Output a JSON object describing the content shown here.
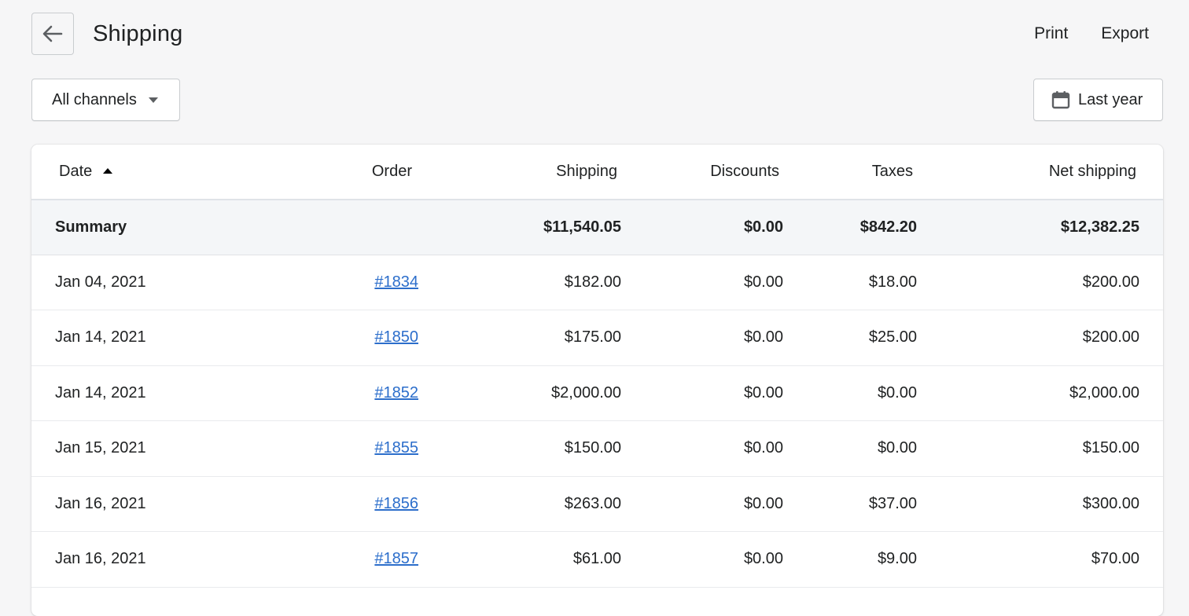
{
  "header": {
    "title": "Shipping",
    "actions": [
      "Print",
      "Export"
    ]
  },
  "filters": {
    "channel": "All channels",
    "date_range": "Last year"
  },
  "table": {
    "columns": [
      "Date",
      "Order",
      "Shipping",
      "Discounts",
      "Taxes",
      "Net shipping"
    ],
    "sort": {
      "column": "Date",
      "direction": "ascending"
    },
    "summary": {
      "label": "Summary",
      "shipping": "$11,540.05",
      "discounts": "$0.00",
      "taxes": "$842.20",
      "net_shipping": "$12,382.25"
    },
    "rows": [
      {
        "date": "Jan 04, 2021",
        "order": "#1834",
        "shipping": "$182.00",
        "discounts": "$0.00",
        "taxes": "$18.00",
        "net_shipping": "$200.00"
      },
      {
        "date": "Jan 14, 2021",
        "order": "#1850",
        "shipping": "$175.00",
        "discounts": "$0.00",
        "taxes": "$25.00",
        "net_shipping": "$200.00"
      },
      {
        "date": "Jan 14, 2021",
        "order": "#1852",
        "shipping": "$2,000.00",
        "discounts": "$0.00",
        "taxes": "$0.00",
        "net_shipping": "$2,000.00"
      },
      {
        "date": "Jan 15, 2021",
        "order": "#1855",
        "shipping": "$150.00",
        "discounts": "$0.00",
        "taxes": "$0.00",
        "net_shipping": "$150.00"
      },
      {
        "date": "Jan 16, 2021",
        "order": "#1856",
        "shipping": "$263.00",
        "discounts": "$0.00",
        "taxes": "$37.00",
        "net_shipping": "$300.00"
      },
      {
        "date": "Jan 16, 2021",
        "order": "#1857",
        "shipping": "$61.00",
        "discounts": "$0.00",
        "taxes": "$9.00",
        "net_shipping": "$70.00"
      }
    ]
  },
  "colors": {
    "background": "#f6f6f7",
    "link": "#2c6ecb",
    "summary_bg": "#f4f6f8",
    "text": "#202223"
  },
  "icons": {
    "back": "arrow-left-icon",
    "channel_dropdown": "caret-down-icon",
    "date": "calendar-icon",
    "sort": "sort-ascending-icon"
  }
}
